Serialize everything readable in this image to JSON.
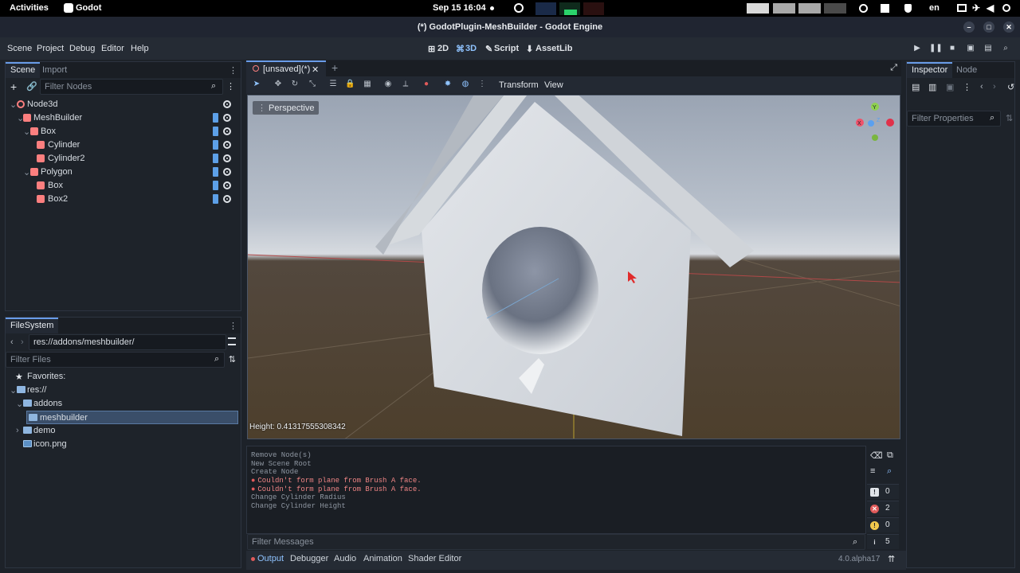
{
  "topbar": {
    "activities": "Activities",
    "app": "Godot",
    "datetime": "Sep 15  16:04",
    "lang": "en"
  },
  "window": {
    "title": "(*) GodotPlugin-MeshBuilder - Godot Engine"
  },
  "menu": {
    "scene": "Scene",
    "project": "Project",
    "debug": "Debug",
    "editor": "Editor",
    "help": "Help"
  },
  "modes": {
    "m2d": "2D",
    "m3d": "3D",
    "script": "Script",
    "assetlib": "AssetLib"
  },
  "scene_dock": {
    "tab_scene": "Scene",
    "tab_import": "Import",
    "filter_placeholder": "Filter Nodes",
    "nodes": [
      {
        "label": "Node3d"
      },
      {
        "label": "MeshBuilder"
      },
      {
        "label": "Box"
      },
      {
        "label": "Cylinder"
      },
      {
        "label": "Cylinder2"
      },
      {
        "label": "Polygon"
      },
      {
        "label": "Box"
      },
      {
        "label": "Box2"
      }
    ]
  },
  "filesystem": {
    "tab": "FileSystem",
    "path": "res://addons/meshbuilder/",
    "filter_placeholder": "Filter Files",
    "favorites": "Favorites:",
    "items": [
      {
        "label": "res://"
      },
      {
        "label": "addons"
      },
      {
        "label": "meshbuilder"
      },
      {
        "label": "demo"
      },
      {
        "label": "icon.png"
      }
    ]
  },
  "viewport": {
    "tab": "[unsaved](*)",
    "transform": "Transform",
    "view": "View",
    "perspective": "Perspective",
    "status": "Height: 0.41317555308342",
    "gizmo": {
      "y": "Y",
      "x": "X",
      "z": "Z"
    }
  },
  "inspector": {
    "tab_inspector": "Inspector",
    "tab_node": "Node",
    "filter_placeholder": "Filter Properties"
  },
  "output": {
    "lines": [
      {
        "text": "Remove Node(s)",
        "err": false
      },
      {
        "text": "New Scene Root",
        "err": false
      },
      {
        "text": "Create Node",
        "err": false
      },
      {
        "text": "Couldn't form plane from Brush A face.",
        "err": true
      },
      {
        "text": "Couldn't form plane from Brush A face.",
        "err": true
      },
      {
        "text": "Change Cylinder Radius",
        "err": false
      },
      {
        "text": "Change Cylinder Height",
        "err": false
      }
    ],
    "filter_placeholder": "Filter Messages",
    "counts": {
      "messages": "0",
      "errors": "2",
      "warnings": "0",
      "info": "5"
    }
  },
  "bottom_tabs": {
    "output": "Output",
    "debugger": "Debugger",
    "audio": "Audio",
    "animation": "Animation",
    "shader": "Shader Editor"
  },
  "version": "4.0.alpha17",
  "colors": {
    "accent": "#699ce8",
    "error": "#e05a5a",
    "node3d": "#fc7f7f",
    "mesh": "#fc7f7f"
  }
}
